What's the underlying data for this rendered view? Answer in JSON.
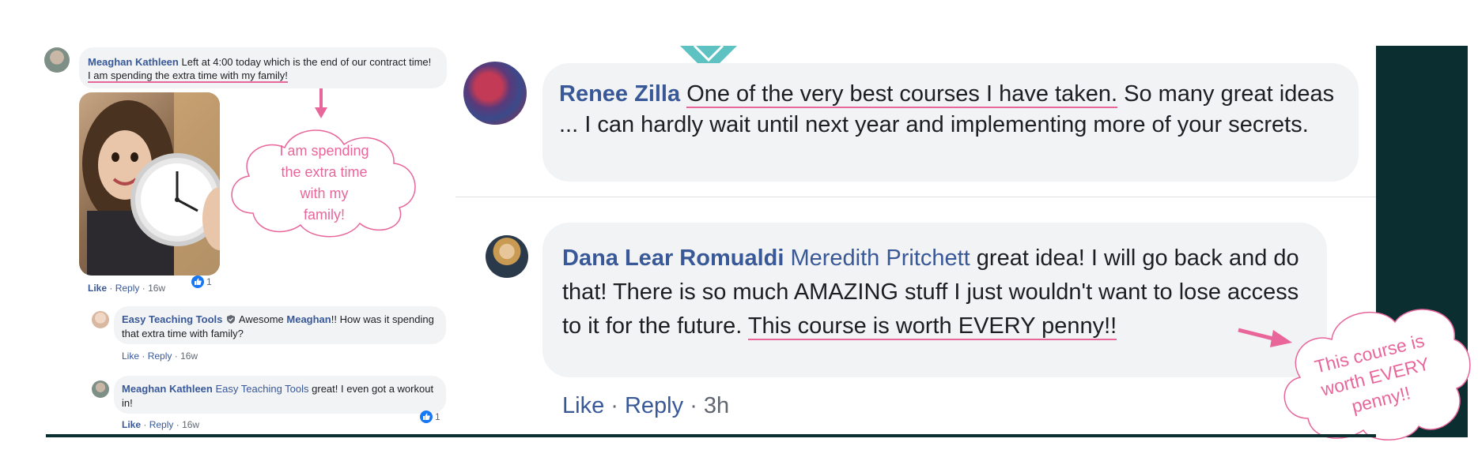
{
  "left": {
    "post1": {
      "author": "Meaghan Kathleen",
      "text_before": "Left at 4:00 today which is the end of our contract time! ",
      "text_highlight": "I am spending the extra time with my family!",
      "actions": {
        "like": "Like",
        "reply": "Reply",
        "time": "16w",
        "reactions": "1"
      }
    },
    "cloud1": {
      "line1": "I am spending",
      "line2": "the extra time",
      "line3": "with my",
      "line4": "family!"
    },
    "reply1": {
      "author": "Easy Teaching Tools",
      "text_before": "Awesome ",
      "mention": "Meaghan",
      "text_after": "!! How was it spending that extra time with family?",
      "actions": {
        "like": "Like",
        "reply": "Reply",
        "time": "16w"
      }
    },
    "reply2": {
      "author": "Meaghan Kathleen",
      "mention": "Easy Teaching Tools",
      "text": " great! I even got a workout in!",
      "actions": {
        "like": "Like",
        "reply": "Reply",
        "time": "16w",
        "reactions": "1"
      }
    }
  },
  "right": {
    "comment1": {
      "author": "Renee Zilla",
      "text_highlight": "One of the very best courses I have taken.",
      "text_after": " So many great ideas ... I can hardly wait until next year and implementing more of your secrets."
    },
    "comment2": {
      "author": "Dana Lear Romualdi",
      "mention": "Meredith Pritchett",
      "text_before": " great idea! I will go back and do that! There is so much AMAZING stuff I just wouldn't want to lose access to it for the future. ",
      "text_highlight": "This course is worth EVERY penny!!",
      "actions": {
        "like": "Like",
        "reply": "Reply",
        "time": "3h"
      }
    },
    "cloud2": {
      "line1": "This course is",
      "line2": "worth EVERY",
      "line3": "penny!!"
    }
  },
  "colors": {
    "accent_pink": "#e8669a",
    "teal": "#5fc2c2",
    "dark_panel": "#0b2e31",
    "fb_link": "#385898"
  }
}
